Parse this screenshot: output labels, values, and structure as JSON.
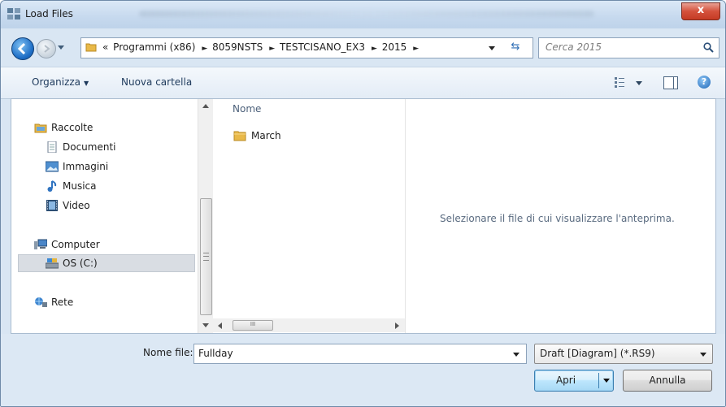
{
  "window": {
    "title": "Load Files",
    "close_label": "x"
  },
  "address": {
    "overflow": "«",
    "crumbs": [
      "Programmi (x86)",
      "8059NSTS",
      "TESTCISANO_EX3",
      "2015"
    ],
    "search_placeholder": "Cerca 2015"
  },
  "toolbar": {
    "organize_label": "Organizza",
    "new_folder_label": "Nuova cartella",
    "help_label": "?"
  },
  "nav": {
    "favorites_label": "Raccolte",
    "libraries": [
      "Documenti",
      "Immagini",
      "Musica",
      "Video"
    ],
    "computer_label": "Computer",
    "drive_label": "OS (C:)",
    "network_label": "Rete"
  },
  "files": {
    "column_name": "Nome",
    "items": [
      "March"
    ],
    "scroll_glyph": "III"
  },
  "preview": {
    "message": "Selezionare il file di cui visualizzare l'anteprima."
  },
  "footer": {
    "filename_label": "Nome file:",
    "filename_value": "Fullday",
    "filetype_value": "Draft [Diagram]  (*.RS9)",
    "open_label": "Apri",
    "cancel_label": "Annulla"
  },
  "colors": {
    "accent": "#1e6ec6",
    "window_bg": "#d9e6f3",
    "folder": "#e9b949"
  }
}
